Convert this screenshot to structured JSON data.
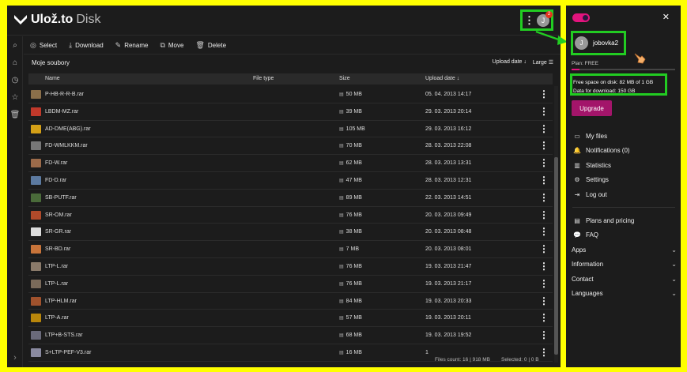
{
  "app": {
    "logo_main": "Ulož.to",
    "logo_sub": "Disk",
    "avatar_initial": "J",
    "notification_count": "2"
  },
  "toolbar": {
    "select": "Select",
    "download": "Download",
    "rename": "Rename",
    "move": "Move",
    "delete": "Delete"
  },
  "breadcrumb": "Moje soubory",
  "sort": {
    "field": "Upload date ↓",
    "view": "Large ☰"
  },
  "table": {
    "columns": [
      "Name",
      "File type",
      "Size",
      "Upload date ↓"
    ],
    "rows": [
      {
        "name": "P-HB-R-R-B.rar",
        "size": "50 MB",
        "date": "05. 04. 2013 14:17",
        "color": "#8a6f4a"
      },
      {
        "name": "LBDM-MZ.rar",
        "size": "39 MB",
        "date": "29. 03. 2013 20:14",
        "color": "#c0392b"
      },
      {
        "name": "AD-DME(ABG).rar",
        "size": "105 MB",
        "date": "29. 03. 2013 16:12",
        "color": "#d4a017"
      },
      {
        "name": "FD-WMLKKM.rar",
        "size": "70 MB",
        "date": "28. 03. 2013 22:08",
        "color": "#777777"
      },
      {
        "name": "FD-W.rar",
        "size": "62 MB",
        "date": "28. 03. 2013 13:31",
        "color": "#9c6b4a"
      },
      {
        "name": "FD-D.rar",
        "size": "47 MB",
        "date": "28. 03. 2013 12:31",
        "color": "#5c7aa0"
      },
      {
        "name": "SB-PUTF.rar",
        "size": "89 MB",
        "date": "22. 03. 2013 14:51",
        "color": "#4a6b3a"
      },
      {
        "name": "SR-OM.rar",
        "size": "76 MB",
        "date": "20. 03. 2013 09:49",
        "color": "#b04a2a"
      },
      {
        "name": "SR-GR.rar",
        "size": "38 MB",
        "date": "20. 03. 2013 08:48",
        "color": "#dddddd"
      },
      {
        "name": "SR-BD.rar",
        "size": "7 MB",
        "date": "20. 03. 2013 08:01",
        "color": "#c8743a"
      },
      {
        "name": "LTP-L.rar",
        "size": "76 MB",
        "date": "19. 03. 2013 21:47",
        "color": "#8a7a6a"
      },
      {
        "name": "LTP-L.rar",
        "size": "76 MB",
        "date": "19. 03. 2013 21:17",
        "color": "#7a6a5a"
      },
      {
        "name": "LTP-HLM.rar",
        "size": "84 MB",
        "date": "19. 03. 2013 20:33",
        "color": "#a0522d"
      },
      {
        "name": "LTP-A.rar",
        "size": "57 MB",
        "date": "19. 03. 2013 20:11",
        "color": "#b8860b"
      },
      {
        "name": "LTP+B-STS.rar",
        "size": "68 MB",
        "date": "19. 03. 2013 19:52",
        "color": "#6a6a7a"
      },
      {
        "name": "S+LTP-PEF-V3.rar",
        "size": "16 MB",
        "date": "1",
        "color": "#8a8aa0"
      }
    ]
  },
  "footer": {
    "count": "Files count: 16 | 918 MB",
    "selected": "Selected: 0 | 0 B"
  },
  "panel": {
    "avatar_initial": "J",
    "username": "jobovka2",
    "plan": "Plan: FREE",
    "free_space": "Free space on disk: 82 MB of 1 GB",
    "data_download": "Data for download: 150 GB",
    "upgrade": "Upgrade",
    "menu": [
      "My files",
      "Notifications (0)",
      "Statistics",
      "Settings",
      "Log out"
    ],
    "menu2": [
      "Plans and pricing",
      "FAQ"
    ],
    "accordions": [
      "Apps",
      "Information",
      "Contact",
      "Languages"
    ]
  },
  "colors": {
    "accent": "#e2147d",
    "highlight": "#22cc22",
    "frame": "#ffff00"
  }
}
